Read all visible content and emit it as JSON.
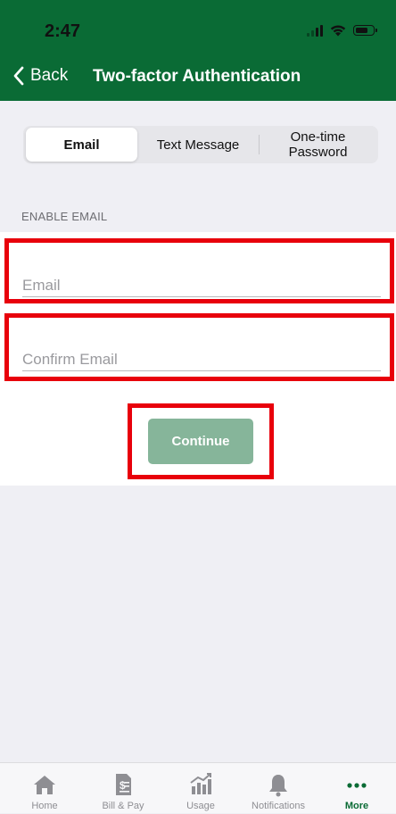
{
  "status_bar": {
    "time": "2:47"
  },
  "nav": {
    "back_label": "Back",
    "title": "Two-factor Authentication"
  },
  "segments": [
    {
      "label": "Email",
      "active": true
    },
    {
      "label": "Text Message",
      "active": false
    },
    {
      "label": "One-time\nPassword",
      "active": false
    }
  ],
  "section": {
    "label": "ENABLE EMAIL"
  },
  "form": {
    "email": {
      "placeholder": "Email",
      "value": ""
    },
    "confirm_email": {
      "placeholder": "Confirm Email",
      "value": ""
    },
    "continue_label": "Continue"
  },
  "tabbar": {
    "items": [
      {
        "label": "Home",
        "icon": "home-icon"
      },
      {
        "label": "Bill & Pay",
        "icon": "bill-icon"
      },
      {
        "label": "Usage",
        "icon": "usage-chart-icon"
      },
      {
        "label": "Notifications",
        "icon": "bell-icon"
      },
      {
        "label": "More",
        "icon": "more-dots-icon",
        "active": true
      }
    ]
  },
  "colors": {
    "brand_green": "#0a6b35",
    "button_disabled": "#86b59a",
    "highlight_red": "#e8000b"
  }
}
